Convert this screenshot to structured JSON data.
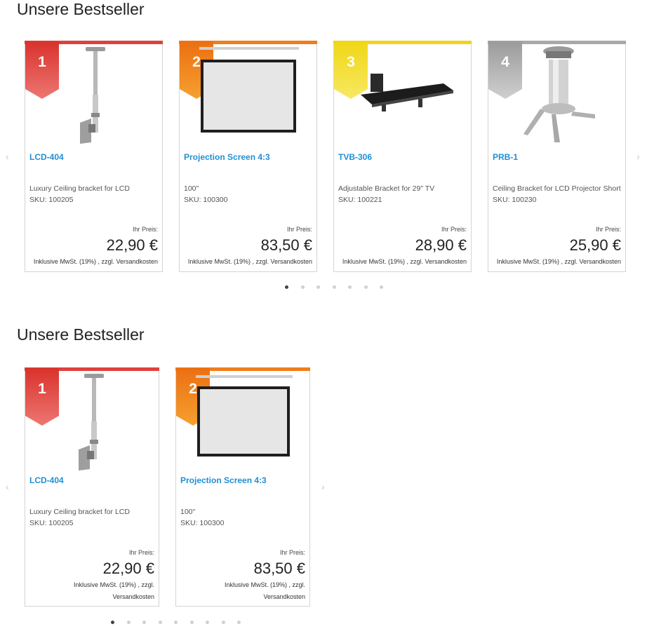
{
  "sections": [
    {
      "title": "Unsere Bestseller",
      "products": [
        {
          "rank": "1",
          "name": "LCD-404",
          "description": "Luxury Ceiling bracket for LCD",
          "sku": "SKU: 100205",
          "price_label": "Ihr Preis:",
          "price": "22,90 €",
          "tax": "Inklusive MwSt. (19%) , zzgl. Versandkosten"
        },
        {
          "rank": "2",
          "name": "Projection Screen 4:3",
          "description": "100\"",
          "sku": "SKU: 100300",
          "price_label": "Ihr Preis:",
          "price": "83,50 €",
          "tax": "Inklusive MwSt. (19%) , zzgl. Versandkosten"
        },
        {
          "rank": "3",
          "name": "TVB-306",
          "description": "Adjustable Bracket for 29\" TV",
          "sku": "SKU: 100221",
          "price_label": "Ihr Preis:",
          "price": "28,90 €",
          "tax": "Inklusive MwSt. (19%) , zzgl. Versandkosten"
        },
        {
          "rank": "4",
          "name": "PRB-1",
          "description": "Ceiling Bracket for LCD Projector Short",
          "sku": "SKU: 100230",
          "price_label": "Ihr Preis:",
          "price": "25,90 €",
          "tax": "Inklusive MwSt. (19%) , zzgl. Versandkosten"
        }
      ],
      "dots": 7,
      "active_dot": 0
    },
    {
      "title": "Unsere Bestseller",
      "products": [
        {
          "rank": "1",
          "name": "LCD-404",
          "description": "Luxury Ceiling bracket for LCD",
          "sku": "SKU: 100205",
          "price_label": "Ihr Preis:",
          "price": "22,90 €",
          "tax_line1": "Inklusive MwSt. (19%) , zzgl.",
          "tax_line2": "Versandkosten"
        },
        {
          "rank": "2",
          "name": "Projection Screen 4:3",
          "description": "100\"",
          "sku": "SKU: 100300",
          "price_label": "Ihr Preis:",
          "price": "83,50 €",
          "tax_line1": "Inklusive MwSt. (19%) , zzgl.",
          "tax_line2": "Versandkosten"
        }
      ],
      "dots": 9,
      "active_dot": 0
    }
  ],
  "icons": {
    "prev": "chevron-left-icon",
    "next": "chevron-right-icon"
  },
  "colors": {
    "rank1": "#e0403a",
    "rank2": "#ef7d1a",
    "rank3": "#f2d21e",
    "rank4": "#a9a9a9",
    "link": "#1f8fd6"
  }
}
